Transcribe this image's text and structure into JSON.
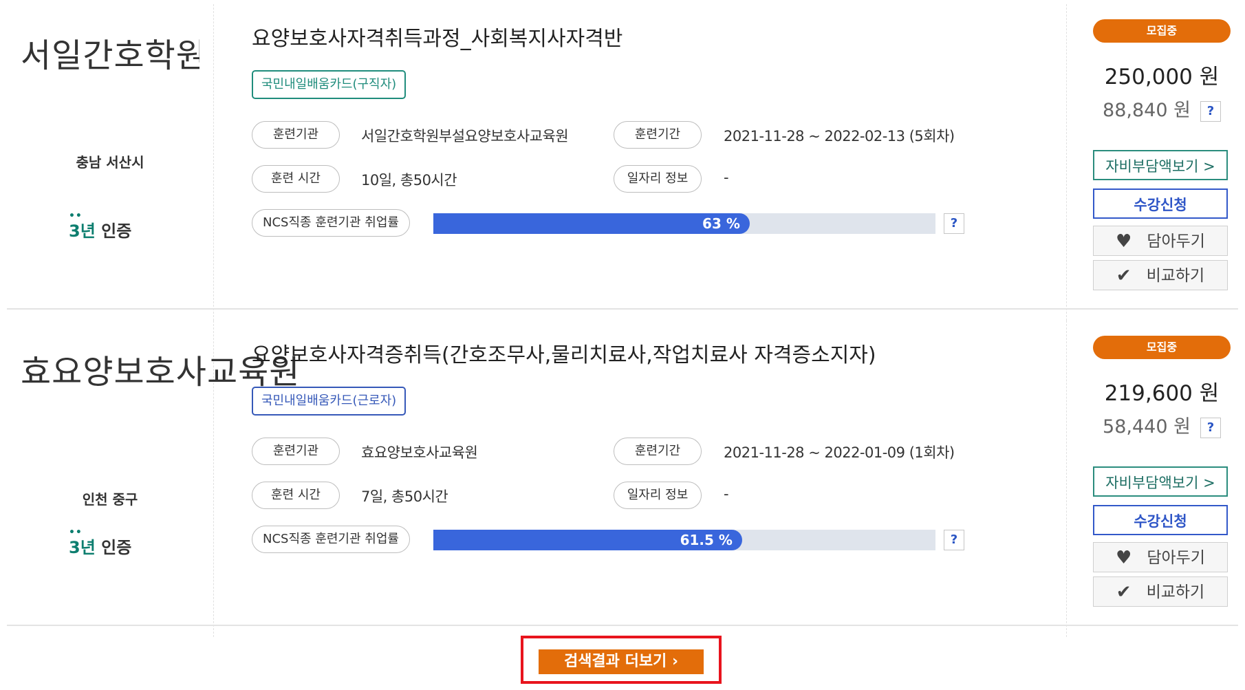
{
  "courses": [
    {
      "institution_name": "서일간호학원부설요양보호사교육원",
      "region": "충남 서산시",
      "certification": {
        "years": "3년",
        "label": "인증"
      },
      "title": "요양보호사자격취득과정_사회복지사자격반",
      "card_type": "국민내일배움카드(구직자)",
      "training_org_label": "훈련기관",
      "training_org": "서일간호학원부설요양보호사교육원",
      "period_label": "훈련기간",
      "period": "2021-11-28 ~ 2022-02-13 (5회차)",
      "hours_label": "훈련 시간",
      "hours": "10일, 총50시간",
      "job_info_label": "일자리 정보",
      "job_info": "-",
      "employment_rate_label": "NCS직종 훈련기관 취업률",
      "employment_rate": 63,
      "employment_rate_text": "63 %",
      "status": "모집중",
      "price": "250,000 원",
      "self_pay": "88,840 원",
      "help": "?",
      "self_pay_button": "자비부담액보기 >",
      "apply_button": "수강신청",
      "wishlist_button": "담아두기",
      "compare_button": "비교하기"
    },
    {
      "institution_name": "효요양보호사교육원",
      "region": "인천 중구",
      "certification": {
        "years": "3년",
        "label": "인증"
      },
      "title": "요양보호사자격증취득(간호조무사,물리치료사,작업치료사 자격증소지자)",
      "card_type": "국민내일배움카드(근로자)",
      "training_org_label": "훈련기관",
      "training_org": "효요양보호사교육원",
      "period_label": "훈련기간",
      "period": "2021-11-28 ~ 2022-01-09 (1회차)",
      "hours_label": "훈련 시간",
      "hours": "7일, 총50시간",
      "job_info_label": "일자리 정보",
      "job_info": "-",
      "employment_rate_label": "NCS직종 훈련기관 취업률",
      "employment_rate": 61.5,
      "employment_rate_text": "61.5 %",
      "status": "모집중",
      "price": "219,600 원",
      "self_pay": "58,440 원",
      "help": "?",
      "self_pay_button": "자비부담액보기 >",
      "apply_button": "수강신청",
      "wishlist_button": "담아두기",
      "compare_button": "비교하기"
    }
  ],
  "icons": {
    "wishlist": "heart-icon",
    "compare": "check-icon",
    "more": "chevron-right-icon"
  },
  "colors": {
    "status_orange": "#e36d0a",
    "card_job_seeker": "#1f8c7c",
    "card_worker": "#3558b8",
    "progress_blue": "#3966dc",
    "highlight_red": "#e8141d"
  },
  "more_button": {
    "label": "검색결과 더보기",
    "arrow": "›"
  }
}
